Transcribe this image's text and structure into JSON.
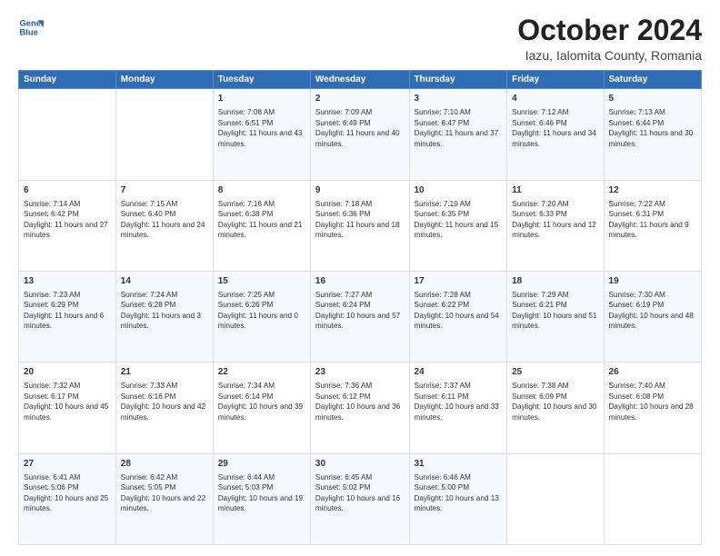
{
  "logo": {
    "line1": "General",
    "line2": "Blue"
  },
  "title": "October 2024",
  "subtitle": "Iazu, Ialomita County, Romania",
  "days_of_week": [
    "Sunday",
    "Monday",
    "Tuesday",
    "Wednesday",
    "Thursday",
    "Friday",
    "Saturday"
  ],
  "weeks": [
    [
      {
        "day": "",
        "sunrise": "",
        "sunset": "",
        "daylight": ""
      },
      {
        "day": "",
        "sunrise": "",
        "sunset": "",
        "daylight": ""
      },
      {
        "day": "1",
        "sunrise": "Sunrise: 7:08 AM",
        "sunset": "Sunset: 6:51 PM",
        "daylight": "Daylight: 11 hours and 43 minutes."
      },
      {
        "day": "2",
        "sunrise": "Sunrise: 7:09 AM",
        "sunset": "Sunset: 6:49 PM",
        "daylight": "Daylight: 11 hours and 40 minutes."
      },
      {
        "day": "3",
        "sunrise": "Sunrise: 7:10 AM",
        "sunset": "Sunset: 6:47 PM",
        "daylight": "Daylight: 11 hours and 37 minutes."
      },
      {
        "day": "4",
        "sunrise": "Sunrise: 7:12 AM",
        "sunset": "Sunset: 6:46 PM",
        "daylight": "Daylight: 11 hours and 34 minutes."
      },
      {
        "day": "5",
        "sunrise": "Sunrise: 7:13 AM",
        "sunset": "Sunset: 6:44 PM",
        "daylight": "Daylight: 11 hours and 30 minutes."
      }
    ],
    [
      {
        "day": "6",
        "sunrise": "Sunrise: 7:14 AM",
        "sunset": "Sunset: 6:42 PM",
        "daylight": "Daylight: 11 hours and 27 minutes."
      },
      {
        "day": "7",
        "sunrise": "Sunrise: 7:15 AM",
        "sunset": "Sunset: 6:40 PM",
        "daylight": "Daylight: 11 hours and 24 minutes."
      },
      {
        "day": "8",
        "sunrise": "Sunrise: 7:16 AM",
        "sunset": "Sunset: 6:38 PM",
        "daylight": "Daylight: 11 hours and 21 minutes."
      },
      {
        "day": "9",
        "sunrise": "Sunrise: 7:18 AM",
        "sunset": "Sunset: 6:36 PM",
        "daylight": "Daylight: 11 hours and 18 minutes."
      },
      {
        "day": "10",
        "sunrise": "Sunrise: 7:19 AM",
        "sunset": "Sunset: 6:35 PM",
        "daylight": "Daylight: 11 hours and 15 minutes."
      },
      {
        "day": "11",
        "sunrise": "Sunrise: 7:20 AM",
        "sunset": "Sunset: 6:33 PM",
        "daylight": "Daylight: 11 hours and 12 minutes."
      },
      {
        "day": "12",
        "sunrise": "Sunrise: 7:22 AM",
        "sunset": "Sunset: 6:31 PM",
        "daylight": "Daylight: 11 hours and 9 minutes."
      }
    ],
    [
      {
        "day": "13",
        "sunrise": "Sunrise: 7:23 AM",
        "sunset": "Sunset: 6:29 PM",
        "daylight": "Daylight: 11 hours and 6 minutes."
      },
      {
        "day": "14",
        "sunrise": "Sunrise: 7:24 AM",
        "sunset": "Sunset: 6:28 PM",
        "daylight": "Daylight: 11 hours and 3 minutes."
      },
      {
        "day": "15",
        "sunrise": "Sunrise: 7:25 AM",
        "sunset": "Sunset: 6:26 PM",
        "daylight": "Daylight: 11 hours and 0 minutes."
      },
      {
        "day": "16",
        "sunrise": "Sunrise: 7:27 AM",
        "sunset": "Sunset: 6:24 PM",
        "daylight": "Daylight: 10 hours and 57 minutes."
      },
      {
        "day": "17",
        "sunrise": "Sunrise: 7:28 AM",
        "sunset": "Sunset: 6:22 PM",
        "daylight": "Daylight: 10 hours and 54 minutes."
      },
      {
        "day": "18",
        "sunrise": "Sunrise: 7:29 AM",
        "sunset": "Sunset: 6:21 PM",
        "daylight": "Daylight: 10 hours and 51 minutes."
      },
      {
        "day": "19",
        "sunrise": "Sunrise: 7:30 AM",
        "sunset": "Sunset: 6:19 PM",
        "daylight": "Daylight: 10 hours and 48 minutes."
      }
    ],
    [
      {
        "day": "20",
        "sunrise": "Sunrise: 7:32 AM",
        "sunset": "Sunset: 6:17 PM",
        "daylight": "Daylight: 10 hours and 45 minutes."
      },
      {
        "day": "21",
        "sunrise": "Sunrise: 7:33 AM",
        "sunset": "Sunset: 6:16 PM",
        "daylight": "Daylight: 10 hours and 42 minutes."
      },
      {
        "day": "22",
        "sunrise": "Sunrise: 7:34 AM",
        "sunset": "Sunset: 6:14 PM",
        "daylight": "Daylight: 10 hours and 39 minutes."
      },
      {
        "day": "23",
        "sunrise": "Sunrise: 7:36 AM",
        "sunset": "Sunset: 6:12 PM",
        "daylight": "Daylight: 10 hours and 36 minutes."
      },
      {
        "day": "24",
        "sunrise": "Sunrise: 7:37 AM",
        "sunset": "Sunset: 6:11 PM",
        "daylight": "Daylight: 10 hours and 33 minutes."
      },
      {
        "day": "25",
        "sunrise": "Sunrise: 7:38 AM",
        "sunset": "Sunset: 6:09 PM",
        "daylight": "Daylight: 10 hours and 30 minutes."
      },
      {
        "day": "26",
        "sunrise": "Sunrise: 7:40 AM",
        "sunset": "Sunset: 6:08 PM",
        "daylight": "Daylight: 10 hours and 28 minutes."
      }
    ],
    [
      {
        "day": "27",
        "sunrise": "Sunrise: 6:41 AM",
        "sunset": "Sunset: 5:06 PM",
        "daylight": "Daylight: 10 hours and 25 minutes."
      },
      {
        "day": "28",
        "sunrise": "Sunrise: 6:42 AM",
        "sunset": "Sunset: 5:05 PM",
        "daylight": "Daylight: 10 hours and 22 minutes."
      },
      {
        "day": "29",
        "sunrise": "Sunrise: 6:44 AM",
        "sunset": "Sunset: 5:03 PM",
        "daylight": "Daylight: 10 hours and 19 minutes."
      },
      {
        "day": "30",
        "sunrise": "Sunrise: 6:45 AM",
        "sunset": "Sunset: 5:02 PM",
        "daylight": "Daylight: 10 hours and 16 minutes."
      },
      {
        "day": "31",
        "sunrise": "Sunrise: 6:46 AM",
        "sunset": "Sunset: 5:00 PM",
        "daylight": "Daylight: 10 hours and 13 minutes."
      },
      {
        "day": "",
        "sunrise": "",
        "sunset": "",
        "daylight": ""
      },
      {
        "day": "",
        "sunrise": "",
        "sunset": "",
        "daylight": ""
      }
    ]
  ]
}
